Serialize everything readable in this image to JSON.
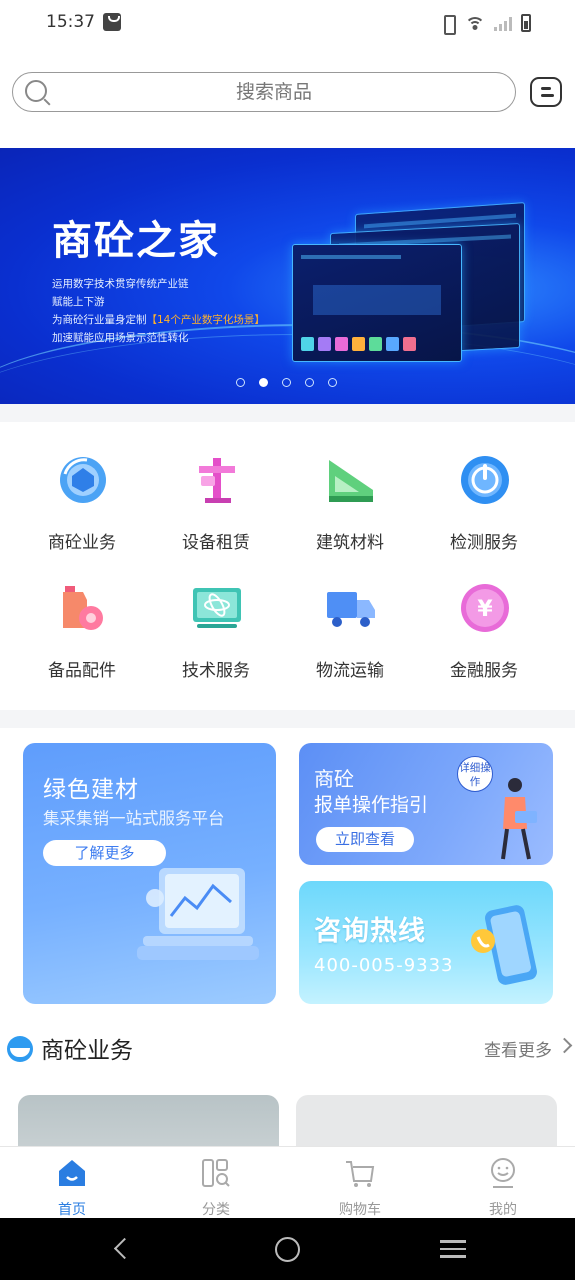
{
  "status_bar": {
    "time": "15:37"
  },
  "search": {
    "placeholder": "搜索商品"
  },
  "banner": {
    "title": "商砼之家",
    "lines": [
      "运用数字技术贯穿传统产业链",
      "赋能上下游",
      "加速赋能应用场景示范性转化"
    ],
    "line3_prefix": "为商砼行业量身定制",
    "line3_highlight": "【14个产业数字化场景】",
    "active_dot": 2,
    "dot_count": 5
  },
  "categories": [
    {
      "label": "商砼业务",
      "icon": "mixer-truck-icon"
    },
    {
      "label": "设备租赁",
      "icon": "crane-icon"
    },
    {
      "label": "建筑材料",
      "icon": "ruler-triangle-icon"
    },
    {
      "label": "检测服务",
      "icon": "gauge-icon"
    },
    {
      "label": "备品配件",
      "icon": "oil-can-icon"
    },
    {
      "label": "技术服务",
      "icon": "atom-screen-icon"
    },
    {
      "label": "物流运输",
      "icon": "delivery-truck-icon"
    },
    {
      "label": "金融服务",
      "icon": "yen-coin-icon"
    }
  ],
  "promos": {
    "green": {
      "title": "绿色建材",
      "subtitle": "集采集销一站式服务平台",
      "button": "了解更多"
    },
    "guide": {
      "title": "商砼",
      "subtitle": "报单操作指引",
      "button": "立即查看",
      "badge": "详细操作"
    },
    "hotline": {
      "title": "咨询热线",
      "phone": "400-005-9333"
    }
  },
  "section": {
    "title": "商砼业务",
    "more": "查看更多"
  },
  "tabs": [
    {
      "label": "首页",
      "icon": "home-icon",
      "active": true
    },
    {
      "label": "分类",
      "icon": "category-icon",
      "active": false
    },
    {
      "label": "购物车",
      "icon": "cart-icon",
      "active": false
    },
    {
      "label": "我的",
      "icon": "profile-icon",
      "active": false
    }
  ],
  "colors": {
    "accent": "#2a7de1",
    "banner": "#1048ea",
    "highlight": "#ffb22c"
  }
}
